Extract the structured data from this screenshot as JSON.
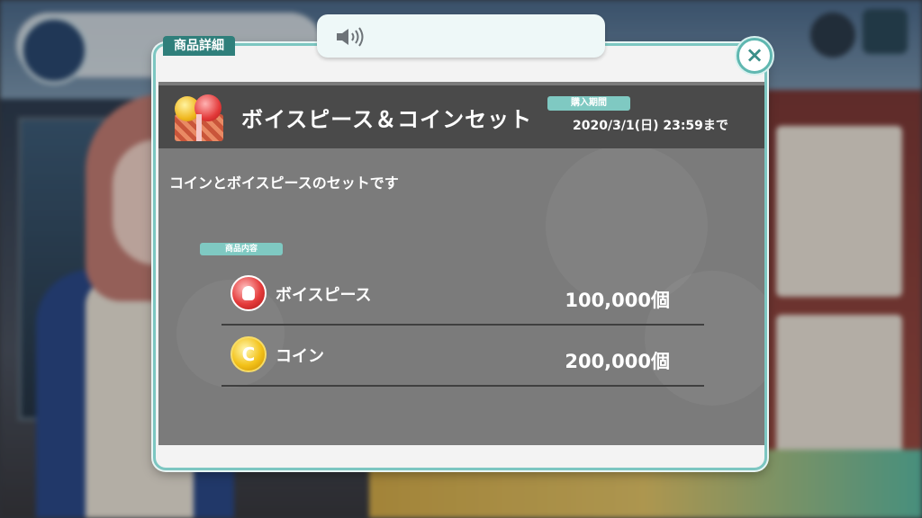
{
  "dialog": {
    "tab_label": "商品詳細",
    "close_icon": "×"
  },
  "item": {
    "title": "ボイスピース＆コインセット",
    "period_label": "購入期間",
    "period_value": "2020/3/1(日) 23:59まで",
    "description": "コインとボイスピースのセットです"
  },
  "contents": {
    "label": "商品内容",
    "rows": [
      {
        "name": "ボイスピース",
        "quantity": "100,000個",
        "icon": "voice-piece-icon"
      },
      {
        "name": "コイン",
        "quantity": "200,000個",
        "icon": "coin-icon"
      }
    ]
  },
  "sound": {
    "icon": "speaker-icon"
  },
  "colors": {
    "accent": "#7cc6c1",
    "header_bg": "#4a4a4a",
    "panel_bg": "#7b7b7b"
  }
}
